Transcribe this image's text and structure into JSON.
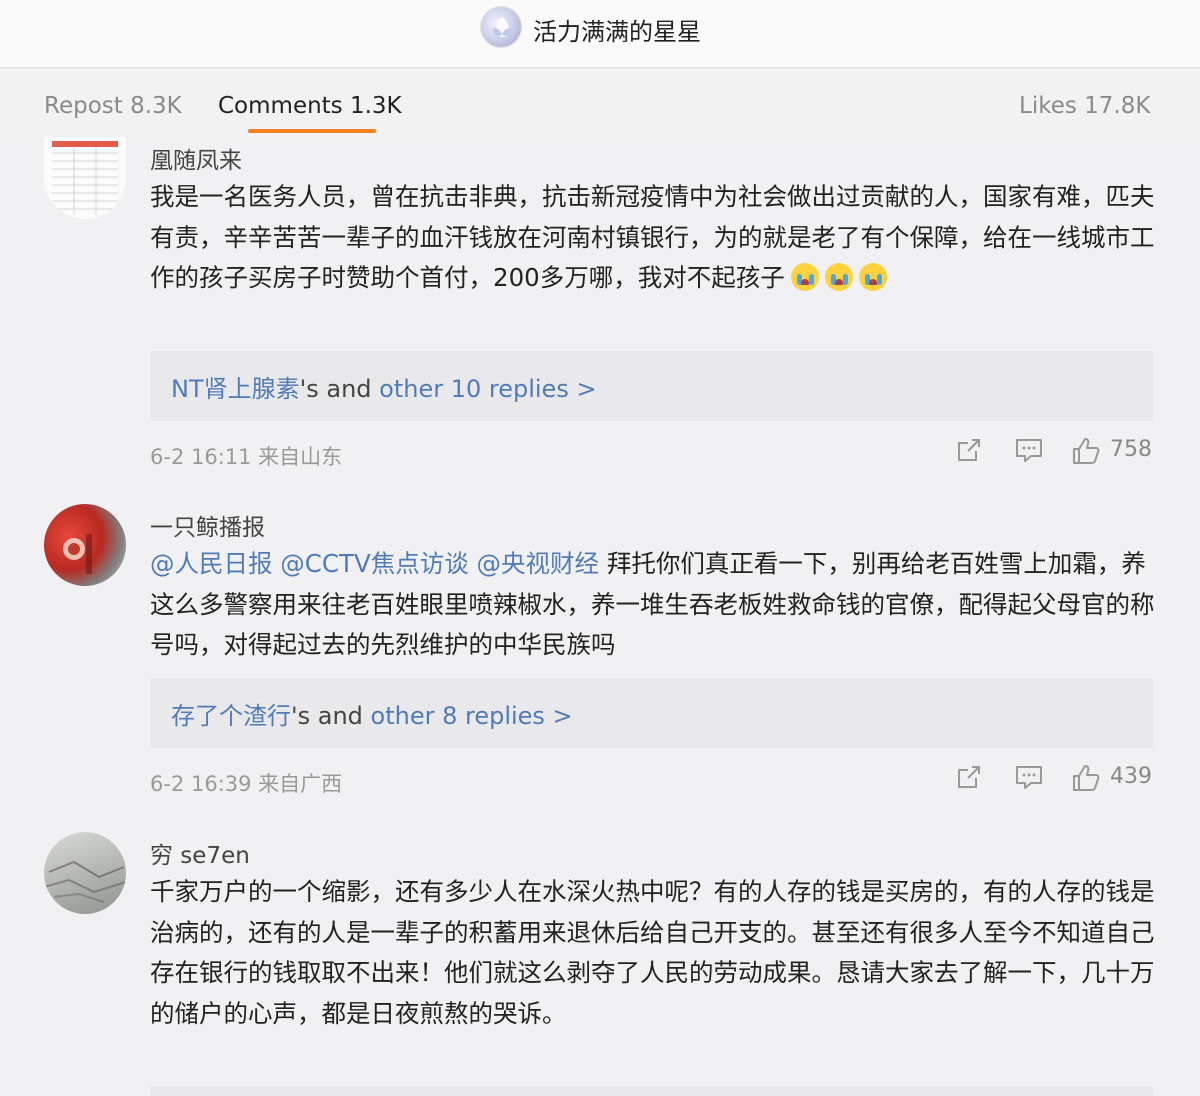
{
  "header": {
    "title": "活力满满的星星",
    "avatar_icon": "user-avatar"
  },
  "tabs": {
    "repost": "Repost 8.3K",
    "comments": "Comments 1.3K",
    "likes": "Likes 17.8K",
    "accent_color": "#f6821f"
  },
  "comments": [
    {
      "username": "凰随凤来",
      "text": "我是一名医务人员，曾在抗击非典，抗击新冠疫情中为社会做出过贡献的人，国家有难，匹夫有责，辛辛苦苦一辈子的血汗钱放在河南村镇银行，为的就是老了有个保障，给在一线城市工作的孩子买房子时赞助个首付，200多万哪，我对不起孩子",
      "emoji_icon": "crying-face-emoji",
      "reply_user": "NT肾上腺素",
      "reply_mid": "'s and ",
      "reply_more": "other 10 replies >",
      "time": "6-2 16:11 来自山东",
      "likes": "758"
    },
    {
      "username": "一只鲸播报",
      "mention_1": "@人民日报",
      "mention_2": "@CCTV焦点访谈",
      "mention_3": "@央视财经",
      "text": "拜托你们真正看一下，别再给老百姓雪上加霜，养这么多警察用来往老百姓眼里喷辣椒水，养一堆生吞老板姓救命钱的官僚，配得起父母官的称号吗，对得起过去的先烈维护的中华民族吗",
      "reply_user": "存了个渣行",
      "reply_mid": "'s and ",
      "reply_more": "other 8 replies >",
      "time": "6-2 16:39 来自广西",
      "likes": "439"
    },
    {
      "username": "穷 se7en",
      "text": "千家万户的一个缩影，还有多少人在水深火热中呢？有的人存的钱是买房的，有的人存的钱是治病的，还有的人是一辈子的积蓄用来退休后给自己开支的。甚至还有很多人至今不知道自己存在银行的钱取取不出来！他们就这么剥夺了人民的劳动成果。恳请大家去了解一下，几十万的储户的心声，都是日夜煎熬的哭诉。"
    }
  ]
}
